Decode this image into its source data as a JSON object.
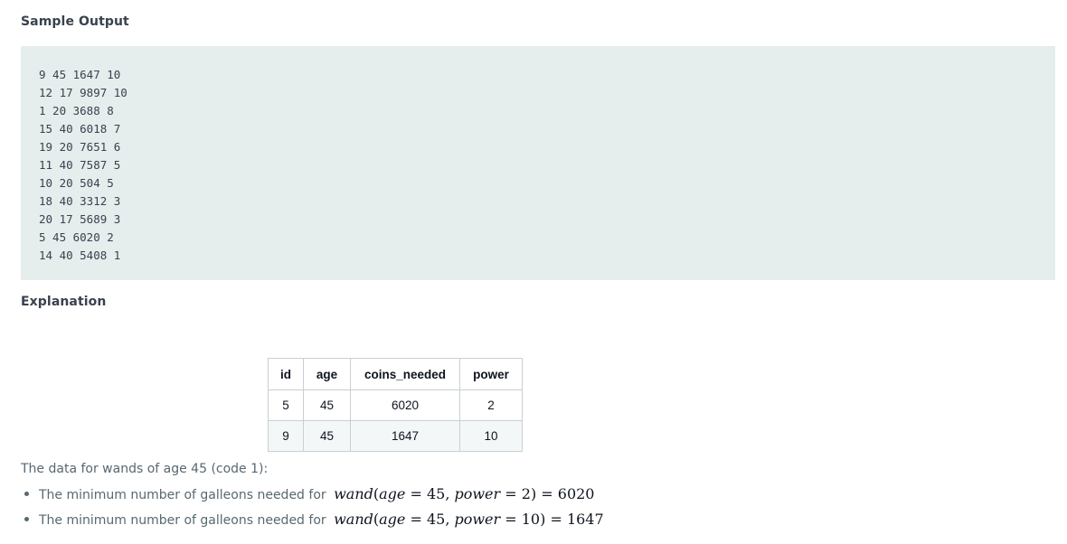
{
  "sample_output": {
    "heading": "Sample Output",
    "lines": [
      "9 45 1647 10",
      "12 17 9897 10",
      "1 20 3688 8",
      "15 40 6018 7",
      "19 20 7651 6",
      "11 40 7587 5",
      "10 20 504 5",
      "18 40 3312 3",
      "20 17 5689 3",
      "5 45 6020 2",
      "14 40 5408 1"
    ]
  },
  "explanation": {
    "heading": "Explanation",
    "table": {
      "headers": [
        "id",
        "age",
        "coins_needed",
        "power"
      ],
      "rows": [
        [
          "5",
          "45",
          "6020",
          "2"
        ],
        [
          "9",
          "45",
          "1647",
          "10"
        ]
      ]
    },
    "paragraph": "The data for wands of age 45 (code 1):",
    "bullets": [
      {
        "text": "The minimum number of galleons needed for",
        "fn": "wand",
        "arg1": "age",
        "val1": "45",
        "arg2": "power",
        "val2": "2",
        "result": "6020"
      },
      {
        "text": "The minimum number of galleons needed for",
        "fn": "wand",
        "arg1": "age",
        "val1": "45",
        "arg2": "power",
        "val2": "10",
        "result": "1647"
      }
    ]
  }
}
